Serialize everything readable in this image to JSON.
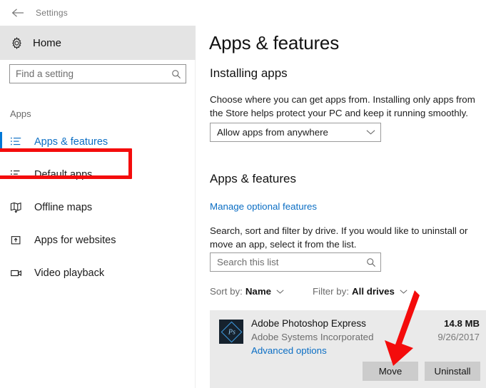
{
  "titlebar": {
    "back_icon": "back-arrow-icon",
    "label": "Settings"
  },
  "sidebar": {
    "home": {
      "label": "Home",
      "icon": "gear-icon"
    },
    "search": {
      "placeholder": "Find a setting",
      "icon": "search-icon"
    },
    "group_label": "Apps",
    "items": [
      {
        "label": "Apps & features",
        "icon": "list-bullet-icon",
        "selected": true
      },
      {
        "label": "Default apps",
        "icon": "list-arrow-icon",
        "selected": false
      },
      {
        "label": "Offline maps",
        "icon": "map-download-icon",
        "selected": false
      },
      {
        "label": "Apps for websites",
        "icon": "box-arrow-up-icon",
        "selected": false
      },
      {
        "label": "Video playback",
        "icon": "video-camera-icon",
        "selected": false
      }
    ],
    "accent_color": "#0078d7",
    "selected_text_color": "#0b6ec4"
  },
  "annotations": {
    "box_color": "#f40c0c",
    "arrow_color": "#f40c0c",
    "box_target": "Apps & features",
    "arrow_target": "Move"
  },
  "main": {
    "page_title": "Apps & features",
    "installing": {
      "heading": "Installing apps",
      "description": "Choose where you can get apps from. Installing only apps from the Store helps protect your PC and keep it running smoothly.",
      "dropdown_value": "Allow apps from anywhere",
      "dropdown_icon": "chevron-down-icon"
    },
    "apps_features": {
      "heading": "Apps & features",
      "optional_link": "Manage optional features",
      "description": "Search, sort and filter by drive. If you would like to uninstall or move an app, select it from the list.",
      "search_placeholder": "Search this list",
      "search_icon": "search-icon",
      "sort_label": "Sort by:",
      "sort_value": "Name",
      "filter_label": "Filter by:",
      "filter_value": "All drives",
      "chevron_icon": "chevron-down-icon"
    },
    "app_entry": {
      "icon": "photoshop-express-icon",
      "icon_text": "Ps",
      "name": "Adobe Photoshop Express",
      "publisher": "Adobe Systems Incorporated",
      "advanced_link": "Advanced options",
      "size": "14.8 MB",
      "date": "9/26/2017",
      "move_button": "Move",
      "uninstall_button": "Uninstall"
    }
  }
}
